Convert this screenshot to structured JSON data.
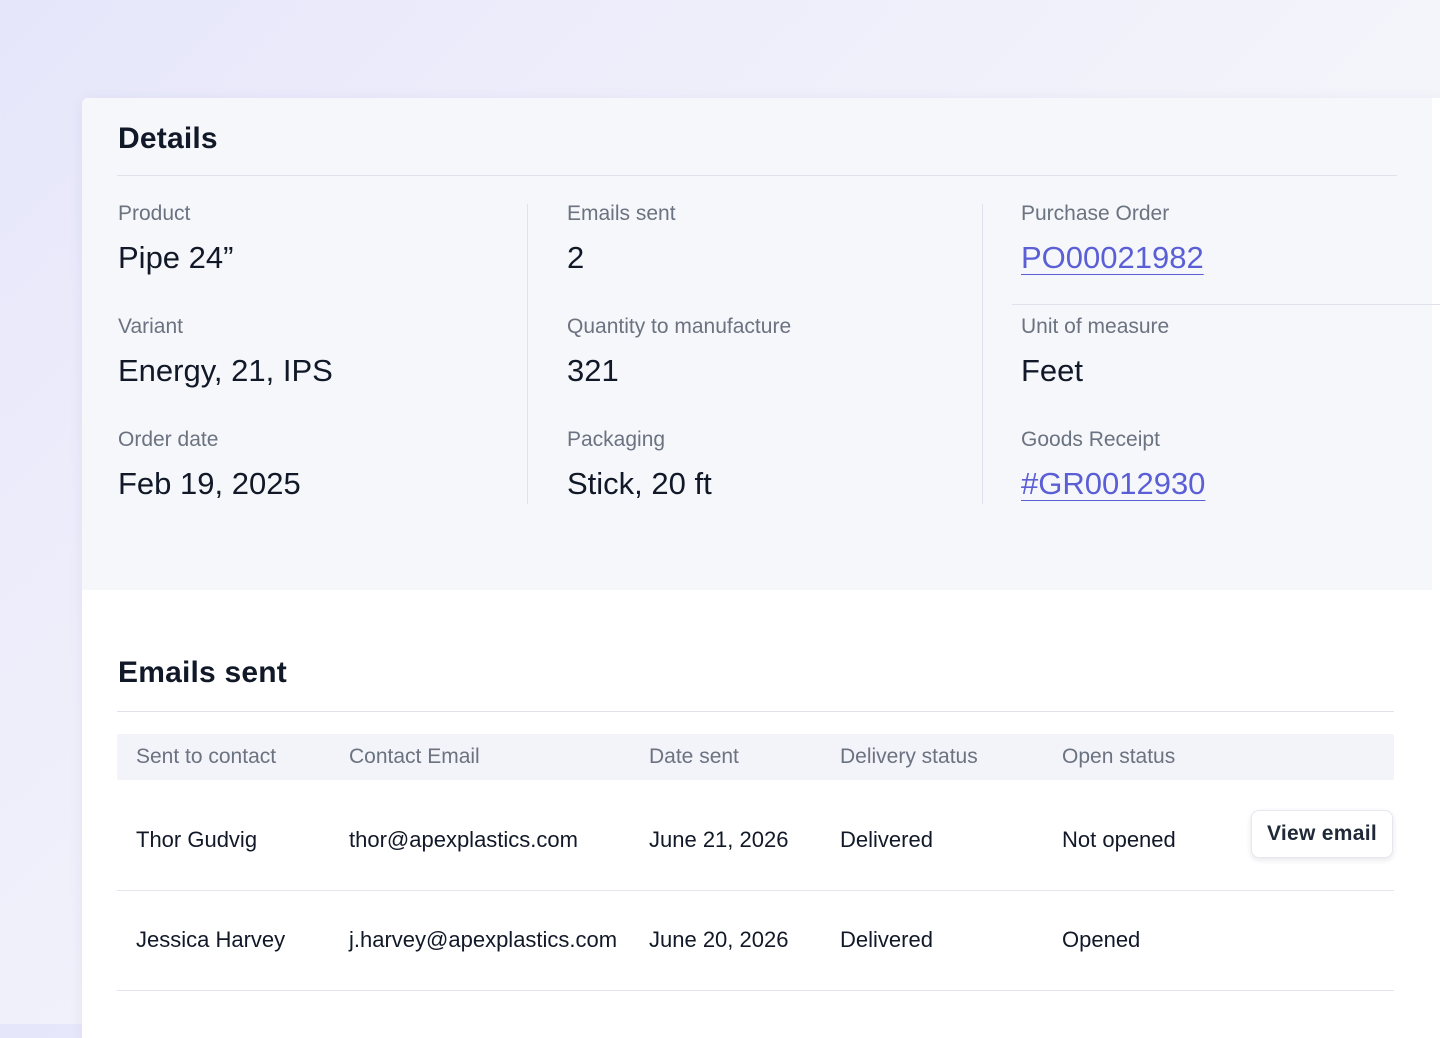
{
  "details": {
    "title": "Details",
    "columns": [
      [
        {
          "label": "Product",
          "value": "Pipe 24”"
        },
        {
          "label": "Variant",
          "value": "Energy, 21, IPS"
        },
        {
          "label": "Order date",
          "value": "Feb 19, 2025"
        }
      ],
      [
        {
          "label": "Emails sent",
          "value": "2"
        },
        {
          "label": "Quantity to manufacture",
          "value": "321"
        },
        {
          "label": "Packaging",
          "value": "Stick, 20 ft"
        }
      ],
      [
        {
          "label": "Purchase Order",
          "value": "PO00021982"
        },
        {
          "label": "Unit of measure",
          "value": "Feet"
        },
        {
          "label": "Goods Receipt",
          "value": "#GR0012930"
        }
      ]
    ]
  },
  "emails": {
    "title": "Emails sent",
    "headers": [
      "Sent to contact",
      "Contact Email",
      "Date sent",
      "Delivery status",
      "Open status"
    ],
    "rows": [
      {
        "contact": "Thor Gudvig",
        "email": "thor@apexplastics.com",
        "date": "June 21, 2026",
        "delivery": "Delivered",
        "open": "Not opened",
        "action": "View email"
      },
      {
        "contact": "Jessica Harvey",
        "email": "j.harvey@apexplastics.com",
        "date": "June 20, 2026",
        "delivery": "Delivered",
        "open": "Opened"
      }
    ]
  },
  "colors": {
    "link": "#5b5fd6",
    "details_background": "#f6f7fb",
    "table_header_background": "#f3f4f9",
    "label_text": "#6b7280",
    "value_text": "#111827"
  }
}
